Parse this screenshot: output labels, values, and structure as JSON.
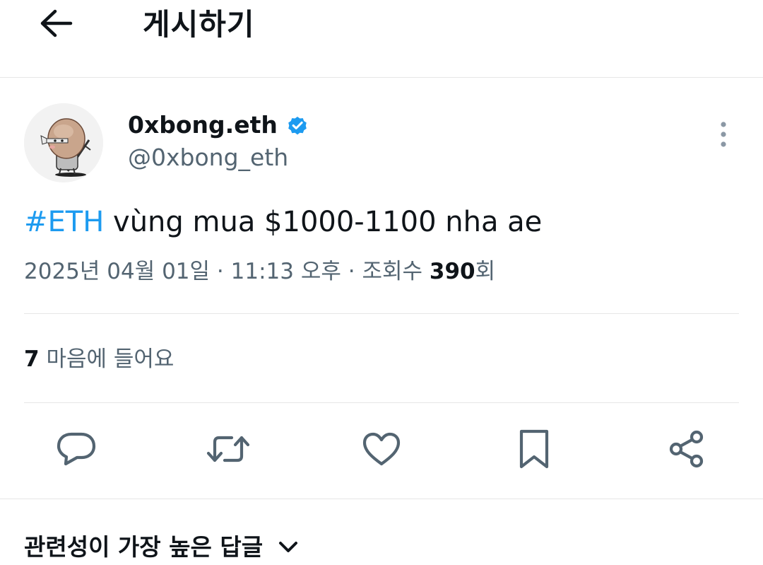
{
  "header": {
    "title": "게시하기",
    "back_icon": "arrow-left-icon"
  },
  "author": {
    "display_name": "0xbong.eth",
    "handle": "@0xbong_eth",
    "verified": true,
    "verified_color": "#1d9bf0",
    "avatar_icon": "mascot-avatar"
  },
  "tweet": {
    "hashtag": "#ETH",
    "text": " vùng mua $1000-1100 nha ae",
    "date": "2025년 04월 01일",
    "separator": "·",
    "time": "11:13 오후",
    "views_label": "조회수",
    "views_count": "390",
    "views_suffix": "회"
  },
  "engagement": {
    "likes_count": "7",
    "likes_label": "마음에 들어요"
  },
  "actions": [
    {
      "name": "reply",
      "icon": "reply-icon"
    },
    {
      "name": "retweet",
      "icon": "retweet-icon"
    },
    {
      "name": "like",
      "icon": "heart-icon"
    },
    {
      "name": "bookmark",
      "icon": "bookmark-icon"
    },
    {
      "name": "share",
      "icon": "share-icon"
    }
  ],
  "replies": {
    "sort_label": "관련성이 가장 높은 답글"
  },
  "colors": {
    "accent": "#1d9bf0",
    "text_primary": "#0f1419",
    "text_secondary": "#536471",
    "divider": "#e6e6e6"
  }
}
